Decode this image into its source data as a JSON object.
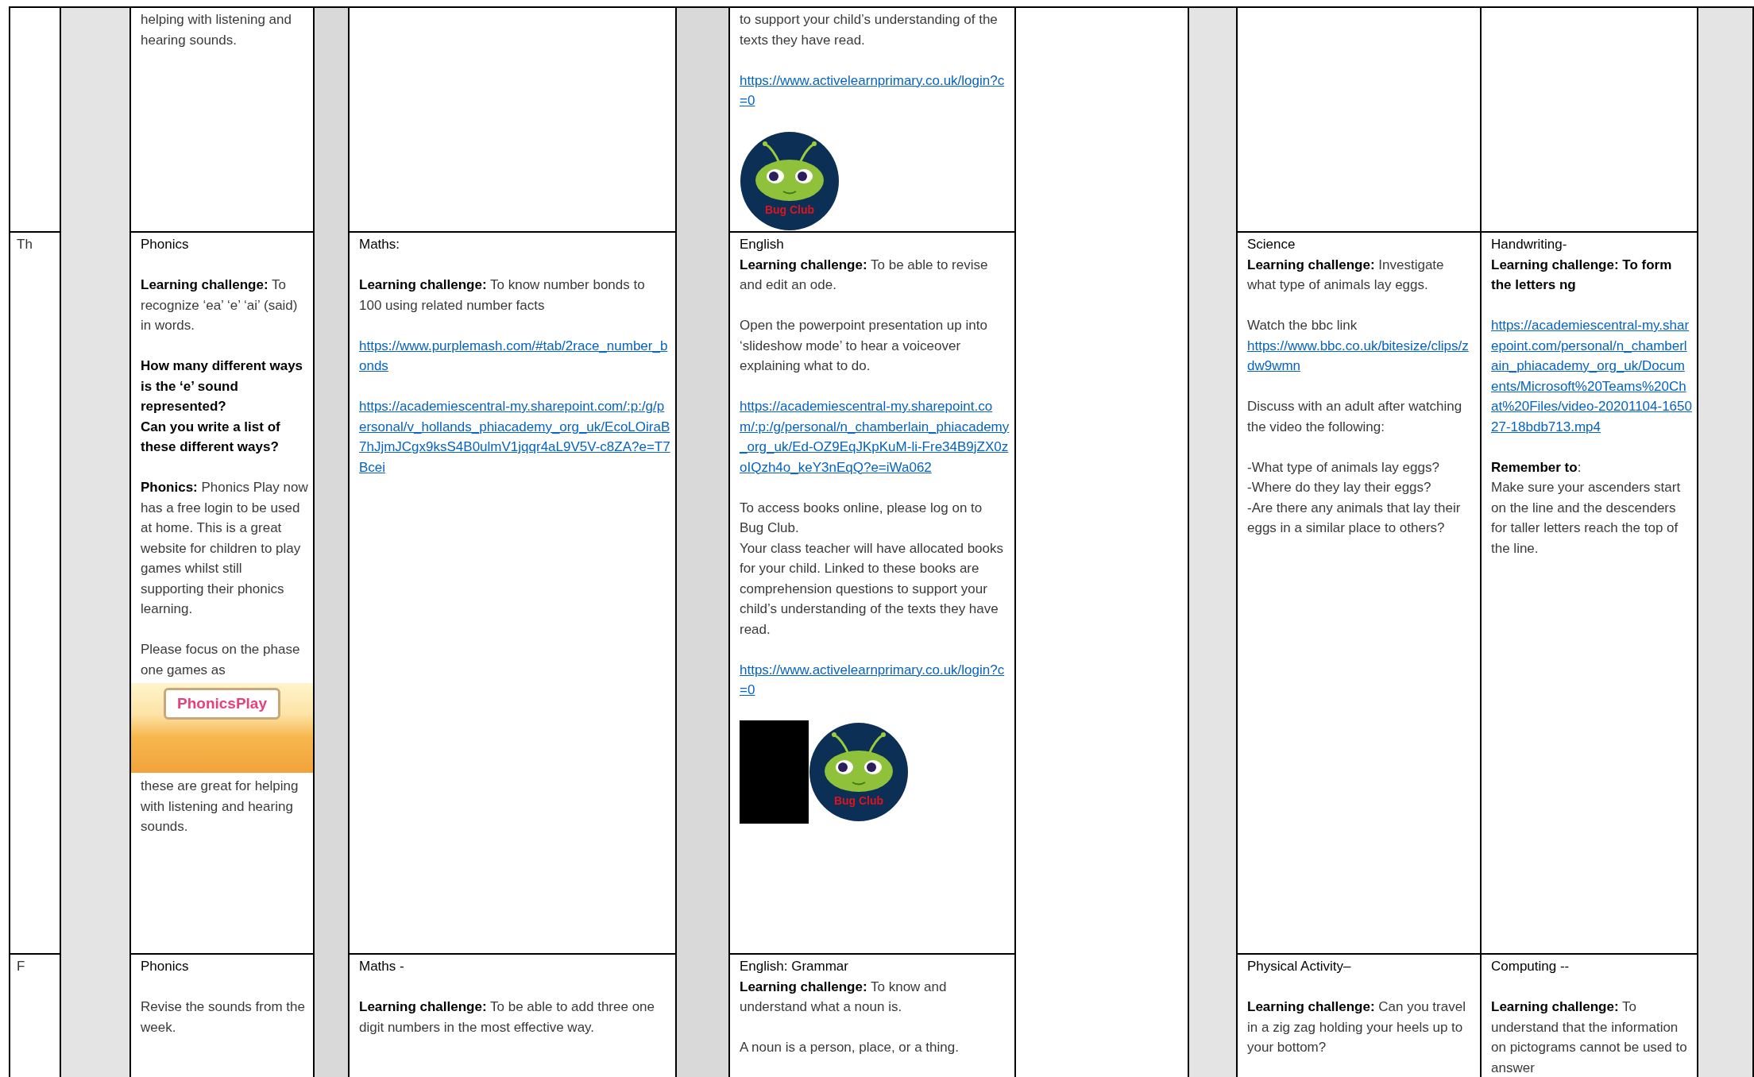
{
  "rows": [
    {
      "column_1": [
        [
          {
            "kind": "text",
            "text": "helping with listening and hearing sounds."
          }
        ]
      ],
      "column_3": [
        [
          {
            "kind": "text",
            "text": "to support your child’s understanding of the texts they have read."
          }
        ],
        [
          {
            "kind": "link",
            "text": "https://www.activelearnprimary.co.uk/login?c=0"
          }
        ],
        [
          {
            "kind": "logo",
            "text": "Bug Club"
          }
        ]
      ]
    },
    {
      "day": "Th",
      "column_1": [
        [
          {
            "kind": "heading",
            "text": "Phonics"
          }
        ],
        [
          {
            "kind": "text",
            "text": "**Learning challenge:** To recognize ‘ea’ ‘e’ ‘ai’ (said) in words."
          }
        ],
        [
          {
            "kind": "bold_text",
            "text": "How many different ways is the ‘e’ sound represented?"
          },
          {
            "kind": "bold_text",
            "text": "Can you write a list of these different ways?"
          }
        ],
        [
          {
            "kind": "text",
            "text": "**Phonics:**  Phonics Play now has a free login to be used at home. This is a great website for children to play games whilst still supporting their phonics learning."
          }
        ],
        [
          {
            "kind": "text",
            "text": "Please focus on the phase one games as"
          },
          {
            "kind": "banner",
            "text": "PhonicsPlay"
          },
          {
            "kind": "text",
            "text": "these are great for helping with listening and hearing sounds."
          }
        ]
      ],
      "column_2": [
        [
          {
            "kind": "heading",
            "text": "Maths:"
          }
        ],
        [
          {
            "kind": "text",
            "text": "**Learning challenge:** To know number bonds to 100  using related number facts"
          }
        ],
        [
          {
            "kind": "link",
            "text": "https://www.purplemash.com/#tab/2race_number_bonds"
          }
        ],
        [
          {
            "kind": "link",
            "text": "https://academiescentral-my.sharepoint.com/:p:/g/personal/v_hollands_phiacademy_org_uk/EcoLOiraB7hJjmJCgx9ksS4B0ulmV1jqqr4aL9V5V-c8ZA?e=T7Bcei"
          }
        ]
      ],
      "column_3": [
        [
          {
            "kind": "heading",
            "text": "English"
          },
          {
            "kind": "text",
            "text": "**Learning challenge:** To be able to revise and edit an ode."
          }
        ],
        [
          {
            "kind": "text",
            "text": "Open the powerpoint presentation up into ‘slideshow mode’ to hear a voiceover explaining what to do."
          }
        ],
        [
          {
            "kind": "link",
            "text": "https://academiescentral-my.sharepoint.com/:p:/g/personal/n_chamberlain_phiacademy_org_uk/Ed-OZ9EqJKpKuM-li-Fre34B9jZX0zoIQzh4o_keY3nEqQ?e=iWa062"
          }
        ],
        [
          {
            "kind": "text",
            "text": "To access books online, please log on to Bug Club."
          },
          {
            "kind": "text",
            "text": "Your class teacher will have allocated books for your child. Linked to these books are comprehension questions to support your child’s understanding of the texts they have read."
          }
        ],
        [
          {
            "kind": "link",
            "text": "https://www.activelearnprimary.co.uk/login?c=0"
          }
        ],
        [
          {
            "kind": "redaction"
          },
          {
            "kind": "logo",
            "text": "Bug Club"
          }
        ]
      ],
      "column_4": [
        [
          {
            "kind": "heading",
            "text": "Science"
          },
          {
            "kind": "text",
            "text": "**Learning challenge:** Investigate what type of animals lay eggs."
          }
        ],
        [
          {
            "kind": "text",
            "text": "Watch the bbc link"
          },
          {
            "kind": "link",
            "text": "https://www.bbc.co.uk/bitesize/clips/zdw9wmn"
          }
        ],
        [
          {
            "kind": "text",
            "text": "Discuss with an adult after watching the video the following:"
          }
        ],
        [
          {
            "kind": "text",
            "text": "-What type of animals lay eggs?"
          },
          {
            "kind": "text",
            "text": "-Where do they lay their eggs?"
          },
          {
            "kind": "text",
            "text": "-Are there any animals that lay their eggs in a similar place to others?"
          }
        ]
      ],
      "column_5": [
        [
          {
            "kind": "heading",
            "text": "Handwriting-"
          },
          {
            "kind": "bold_text",
            "text": "Learning challenge: To form the letters ng"
          }
        ],
        [
          {
            "kind": "link",
            "text": "https://academiescentral-my.sharepoint.com/personal/n_chamberlain_phiacademy_org_uk/Documents/Microsoft%20Teams%20Chat%20Files/video-20201104-165027-18bdb713.mp4"
          }
        ],
        [
          {
            "kind": "text",
            "text": "**Remember to**:"
          },
          {
            "kind": "text",
            "text": "Make sure your ascenders start on the line and the descenders for taller letters reach the top of the line."
          }
        ]
      ]
    },
    {
      "day": "F",
      "column_1": [
        [
          {
            "kind": "heading",
            "text": "Phonics"
          }
        ],
        [
          {
            "kind": "text",
            "text": "Revise the sounds from the week."
          }
        ]
      ],
      "column_2": [
        [
          {
            "kind": "heading",
            "text": "Maths -"
          }
        ],
        [
          {
            "kind": "text",
            "text": "**Learning challenge:** To be able to add three one digit numbers in the most effective way."
          }
        ]
      ],
      "column_3": [
        [
          {
            "kind": "heading",
            "text": "English: Grammar"
          },
          {
            "kind": "text",
            "text": "**Learning challenge:** To know and understand what a noun is."
          }
        ],
        [
          {
            "kind": "text",
            "text": "A noun is a person, place, or a thing."
          }
        ]
      ],
      "column_4": [
        [
          {
            "kind": "heading",
            "text": "Physical Activity–"
          }
        ],
        [
          {
            "kind": "text",
            "text": "**Learning challenge:** Can you travel in a zig zag holding your heels up to your bottom?"
          }
        ]
      ],
      "column_5": [
        [
          {
            "kind": "heading",
            "text": "Computing  --"
          }
        ],
        [
          {
            "kind": "text",
            "text": "**Learning challenge:** To understand that the information on pictograms cannot be used to answer"
          }
        ]
      ]
    }
  ]
}
